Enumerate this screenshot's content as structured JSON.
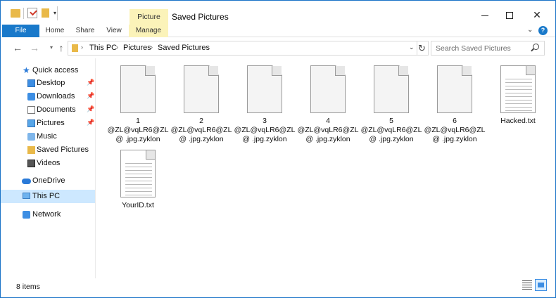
{
  "window": {
    "title": "Saved Pictures",
    "context_tab_header": "Picture Tools"
  },
  "ribbon": {
    "tabs": [
      "File",
      "Home",
      "Share",
      "View",
      "Manage"
    ],
    "help_label": "?"
  },
  "address": {
    "crumbs": [
      "This PC",
      "Pictures",
      "Saved Pictures"
    ],
    "search_placeholder": "Search Saved Pictures"
  },
  "sidebar": {
    "items": [
      {
        "label": "Quick access",
        "icon": "star-icon",
        "pinned": false
      },
      {
        "label": "Desktop",
        "icon": "desktop-icon",
        "pinned": true
      },
      {
        "label": "Downloads",
        "icon": "download-icon",
        "pinned": true
      },
      {
        "label": "Documents",
        "icon": "documents-icon",
        "pinned": true
      },
      {
        "label": "Pictures",
        "icon": "pictures-icon",
        "pinned": true
      },
      {
        "label": "Music",
        "icon": "music-icon",
        "pinned": false
      },
      {
        "label": "Saved Pictures",
        "icon": "folder-icon",
        "pinned": false
      },
      {
        "label": "Videos",
        "icon": "videos-icon",
        "pinned": false
      },
      {
        "label": "OneDrive",
        "icon": "cloud-icon",
        "pinned": false
      },
      {
        "label": "This PC",
        "icon": "computer-icon",
        "pinned": false,
        "selected": true
      },
      {
        "label": "Network",
        "icon": "network-icon",
        "pinned": false
      }
    ]
  },
  "files": [
    {
      "name": "1\n@ZL@vqLR6@ZL\n@ .jpg.zyklon",
      "type": "encrypted"
    },
    {
      "name": "2\n@ZL@vqLR6@ZL\n@ .jpg.zyklon",
      "type": "encrypted"
    },
    {
      "name": "3\n@ZL@vqLR6@ZL\n@ .jpg.zyklon",
      "type": "encrypted"
    },
    {
      "name": "4\n@ZL@vqLR6@ZL\n@ .jpg.zyklon",
      "type": "encrypted"
    },
    {
      "name": "5\n@ZL@vqLR6@ZL\n@ .jpg.zyklon",
      "type": "encrypted"
    },
    {
      "name": "6\n@ZL@vqLR6@ZL\n@ .jpg.zyklon",
      "type": "encrypted"
    },
    {
      "name": "Hacked.txt",
      "type": "text"
    },
    {
      "name": "YourID.txt",
      "type": "text"
    }
  ],
  "status": {
    "item_count": "8 items"
  },
  "colors": {
    "accent": "#1979ca",
    "context_tab": "#fbf3b9",
    "selection": "#cde8ff"
  }
}
